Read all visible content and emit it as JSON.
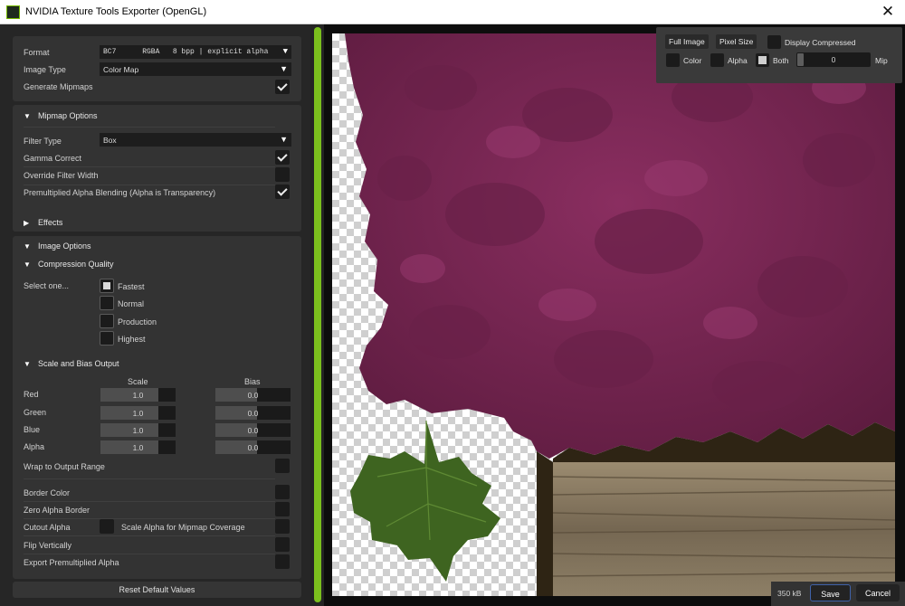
{
  "window": {
    "title": "NVIDIA Texture Tools Exporter (OpenGL)"
  },
  "format": {
    "label": "Format",
    "value": "BC7      RGBA   8 bpp | explicit alpha"
  },
  "image_type": {
    "label": "Image Type",
    "value": "Color Map"
  },
  "generate_mipmaps": {
    "label": "Generate Mipmaps",
    "checked": true
  },
  "mipmap_options": {
    "header": "Mipmap Options",
    "filter_type_label": "Filter Type",
    "filter_type_value": "Box",
    "gamma_correct_label": "Gamma Correct",
    "override_filter_width_label": "Override Filter Width",
    "premultiplied_label": "Premultiplied Alpha Blending (Alpha is Transparency)"
  },
  "effects": {
    "header": "Effects"
  },
  "image_options": {
    "header": "Image Options"
  },
  "compression_quality": {
    "header": "Compression Quality",
    "select_label": "Select one...",
    "options": [
      "Fastest",
      "Normal",
      "Production",
      "Highest"
    ],
    "selected": "Fastest"
  },
  "scale_bias": {
    "header": "Scale and Bias Output",
    "scale_header": "Scale",
    "bias_header": "Bias",
    "rows": [
      {
        "label": "Red",
        "scale": "1.0",
        "bias": "0.0"
      },
      {
        "label": "Green",
        "scale": "1.0",
        "bias": "0.0"
      },
      {
        "label": "Blue",
        "scale": "1.0",
        "bias": "0.0"
      },
      {
        "label": "Alpha",
        "scale": "1.0",
        "bias": "0.0"
      }
    ],
    "wrap_label": "Wrap to Output Range"
  },
  "misc": {
    "border_color": "Border Color",
    "zero_alpha_border": "Zero Alpha Border",
    "cutout_alpha": "Cutout Alpha",
    "scale_alpha_mipmap": "Scale Alpha for Mipmap Coverage",
    "flip_vertically": "Flip Vertically",
    "export_premultiplied": "Export Premultiplied Alpha"
  },
  "reset_button": "Reset Default Values",
  "viewer": {
    "full_image": "Full Image",
    "pixel_size": "Pixel Size",
    "display_compressed": "Display Compressed",
    "color": "Color",
    "alpha": "Alpha",
    "both": "Both",
    "both_checked": true,
    "mip_value": "0",
    "mip_label": "Mip"
  },
  "footer": {
    "size": "350 kB",
    "save": "Save",
    "cancel": "Cancel"
  },
  "colors": {
    "accent_green": "#7bbf1d",
    "panel_bg": "#262626",
    "section_bg": "#333333",
    "leaves_purple": "#7a2553",
    "leaf_green": "#3e6420",
    "wood": "#8a7b62",
    "save_border": "#3f61a8"
  }
}
